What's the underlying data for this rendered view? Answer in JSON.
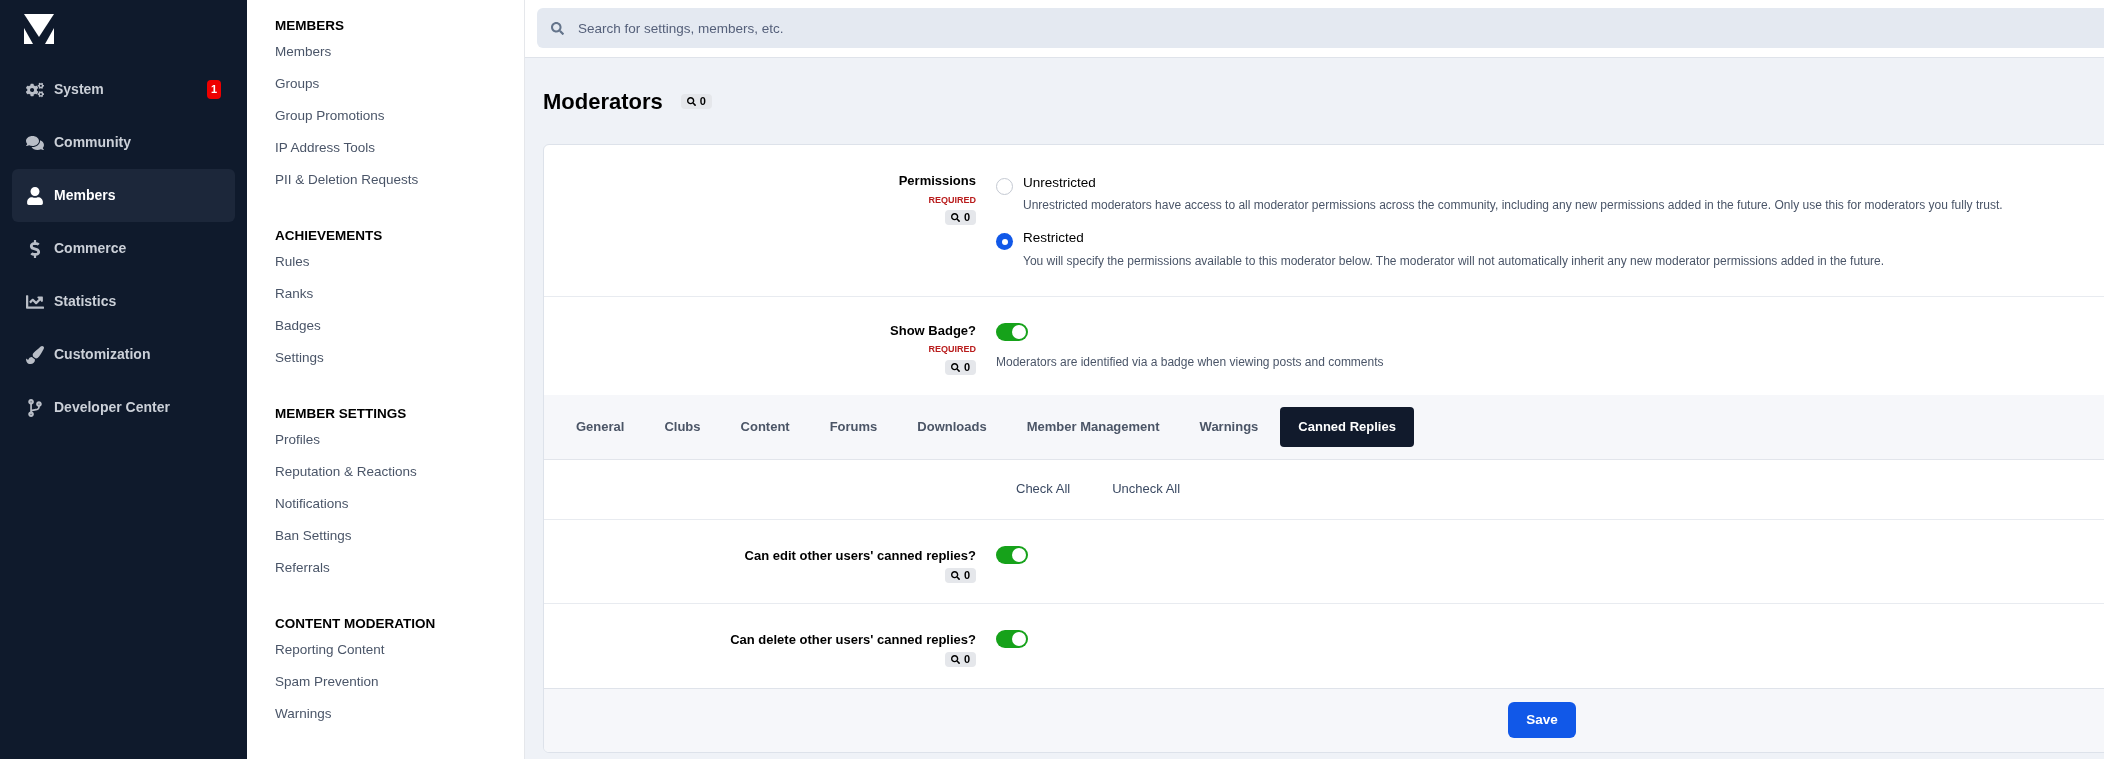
{
  "sidebar": {
    "items": [
      {
        "label": "System",
        "selected": false,
        "badge": "1"
      },
      {
        "label": "Community",
        "selected": false
      },
      {
        "label": "Members",
        "selected": true
      },
      {
        "label": "Commerce",
        "selected": false
      },
      {
        "label": "Statistics",
        "selected": false
      },
      {
        "label": "Customization",
        "selected": false
      },
      {
        "label": "Developer Center",
        "selected": false
      }
    ]
  },
  "submenu": {
    "sections": [
      {
        "heading": "MEMBERS",
        "items": [
          "Members",
          "Groups",
          "Group Promotions",
          "IP Address Tools",
          "PII & Deletion Requests"
        ]
      },
      {
        "heading": "ACHIEVEMENTS",
        "items": [
          "Rules",
          "Ranks",
          "Badges",
          "Settings"
        ]
      },
      {
        "heading": "MEMBER SETTINGS",
        "items": [
          "Profiles",
          "Reputation & Reactions",
          "Notifications",
          "Ban Settings",
          "Referrals"
        ]
      },
      {
        "heading": "CONTENT MODERATION",
        "items": [
          "Reporting Content",
          "Spam Prevention",
          "Warnings"
        ]
      }
    ]
  },
  "search": {
    "placeholder": "Search for settings, members, etc."
  },
  "page": {
    "title": "Moderators",
    "count": "0"
  },
  "permissions": {
    "label": "Permissions",
    "required": "REQUIRED",
    "count": "0",
    "options": [
      {
        "label": "Unrestricted",
        "description": "Unrestricted moderators have access to all moderator permissions across the community, including any new permissions added in the future. Only use this for moderators you fully trust.",
        "selected": false
      },
      {
        "label": "Restricted",
        "description": "You will specify the permissions available to this moderator below. The moderator will not automatically inherit any new moderator permissions added in the future.",
        "selected": true
      }
    ]
  },
  "show_badge": {
    "label": "Show Badge?",
    "required": "REQUIRED",
    "count": "0",
    "on": true,
    "description": "Moderators are identified via a badge when viewing posts and comments"
  },
  "tabs": [
    {
      "label": "General",
      "selected": false
    },
    {
      "label": "Clubs",
      "selected": false
    },
    {
      "label": "Content",
      "selected": false
    },
    {
      "label": "Forums",
      "selected": false
    },
    {
      "label": "Downloads",
      "selected": false
    },
    {
      "label": "Member Management",
      "selected": false
    },
    {
      "label": "Warnings",
      "selected": false
    },
    {
      "label": "Canned Replies",
      "selected": true
    }
  ],
  "bulk_links": [
    "Check All",
    "Uncheck All"
  ],
  "toggles": [
    {
      "label": "Can edit other users' canned replies?",
      "count": "0",
      "on": true
    },
    {
      "label": "Can delete other users' canned replies?",
      "count": "0",
      "on": true
    }
  ],
  "save_button": "Save"
}
